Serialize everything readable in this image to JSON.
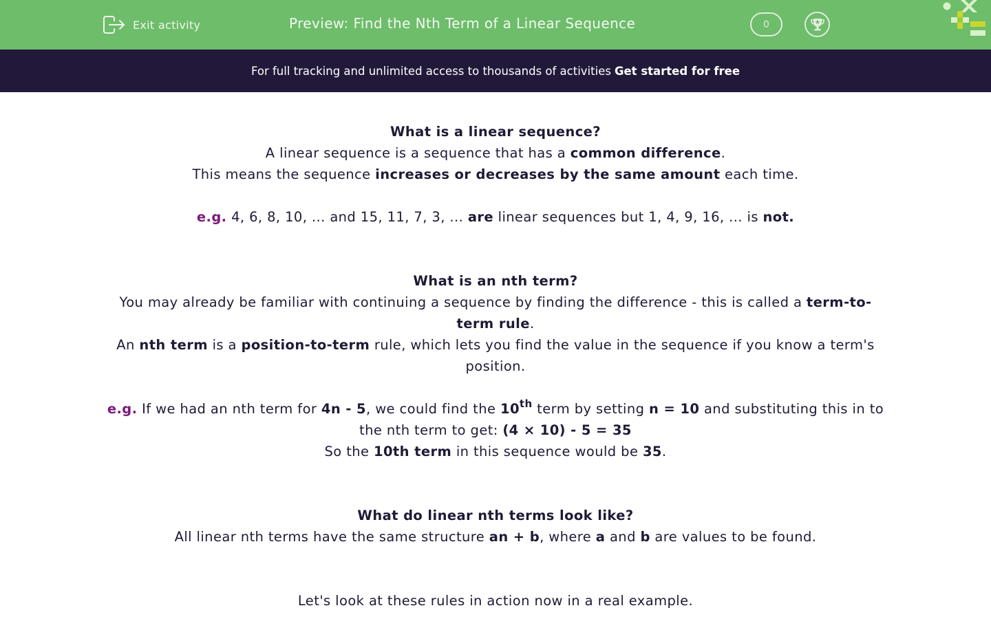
{
  "header": {
    "exit_label": "Exit activity",
    "title": "Preview: Find the Nth Term of a Linear Sequence",
    "score": "0",
    "colors": {
      "header_bg": "#6dbd6a",
      "banner_bg": "#22193a",
      "text": "#1f1a35",
      "accent": "#7a1a7a"
    }
  },
  "banner": {
    "text": "For full tracking and unlimited access to thousands of activities",
    "cta": "Get started for free"
  },
  "sections": {
    "s1": {
      "heading": "What is a linear sequence?",
      "l1a": "A linear sequence is a sequence that has a ",
      "l1b": "common difference",
      "l1c": ".",
      "l2a": "This means the sequence ",
      "l2b": "increases or decreases by the same amount",
      "l2c": " each time.",
      "eg": "e.g.",
      "e1a": " 4, 6, 8, 10, ... and 15, 11, 7, 3, ... ",
      "e1b": "are",
      "e1c": " linear sequences but 1, 4, 9, 16, ... is ",
      "e1d": "not."
    },
    "s2": {
      "heading": "What is an nth term?",
      "l1a": "You may already be familiar with continuing a sequence by finding the difference - this is called a ",
      "l1b": "term-to-term rule",
      "l1c": ".",
      "l2a": "An ",
      "l2b": "nth term",
      "l2c": " is a ",
      "l2d": "position-to-term",
      "l2e": " rule, which lets you find the value in the sequence if you know a term's position.",
      "eg": "e.g.",
      "e1a": " If we had an nth term for ",
      "e1b": "4n - 5",
      "e1c": ", we could find the ",
      "e1d": "10",
      "e1sup": "th",
      "e1e": " term by setting ",
      "e1f": "n = 10",
      "e1g": " and substituting this in to the nth term to get: ",
      "e1h": "(4 × 10) - 5 = 35",
      "e2a": "So the ",
      "e2b": "10th term",
      "e2c": " in this sequence would be ",
      "e2d": "35",
      "e2e": "."
    },
    "s3": {
      "heading": "What do linear nth terms look like?",
      "l1a": "All linear nth terms have the same structure ",
      "l1b": "an + b",
      "l1c": ", where ",
      "l1d": "a",
      "l1e": " and ",
      "l1f": "b",
      "l1g": " are values to be found."
    },
    "s4": {
      "text": "Let's look at these rules in action now in a real example."
    }
  }
}
